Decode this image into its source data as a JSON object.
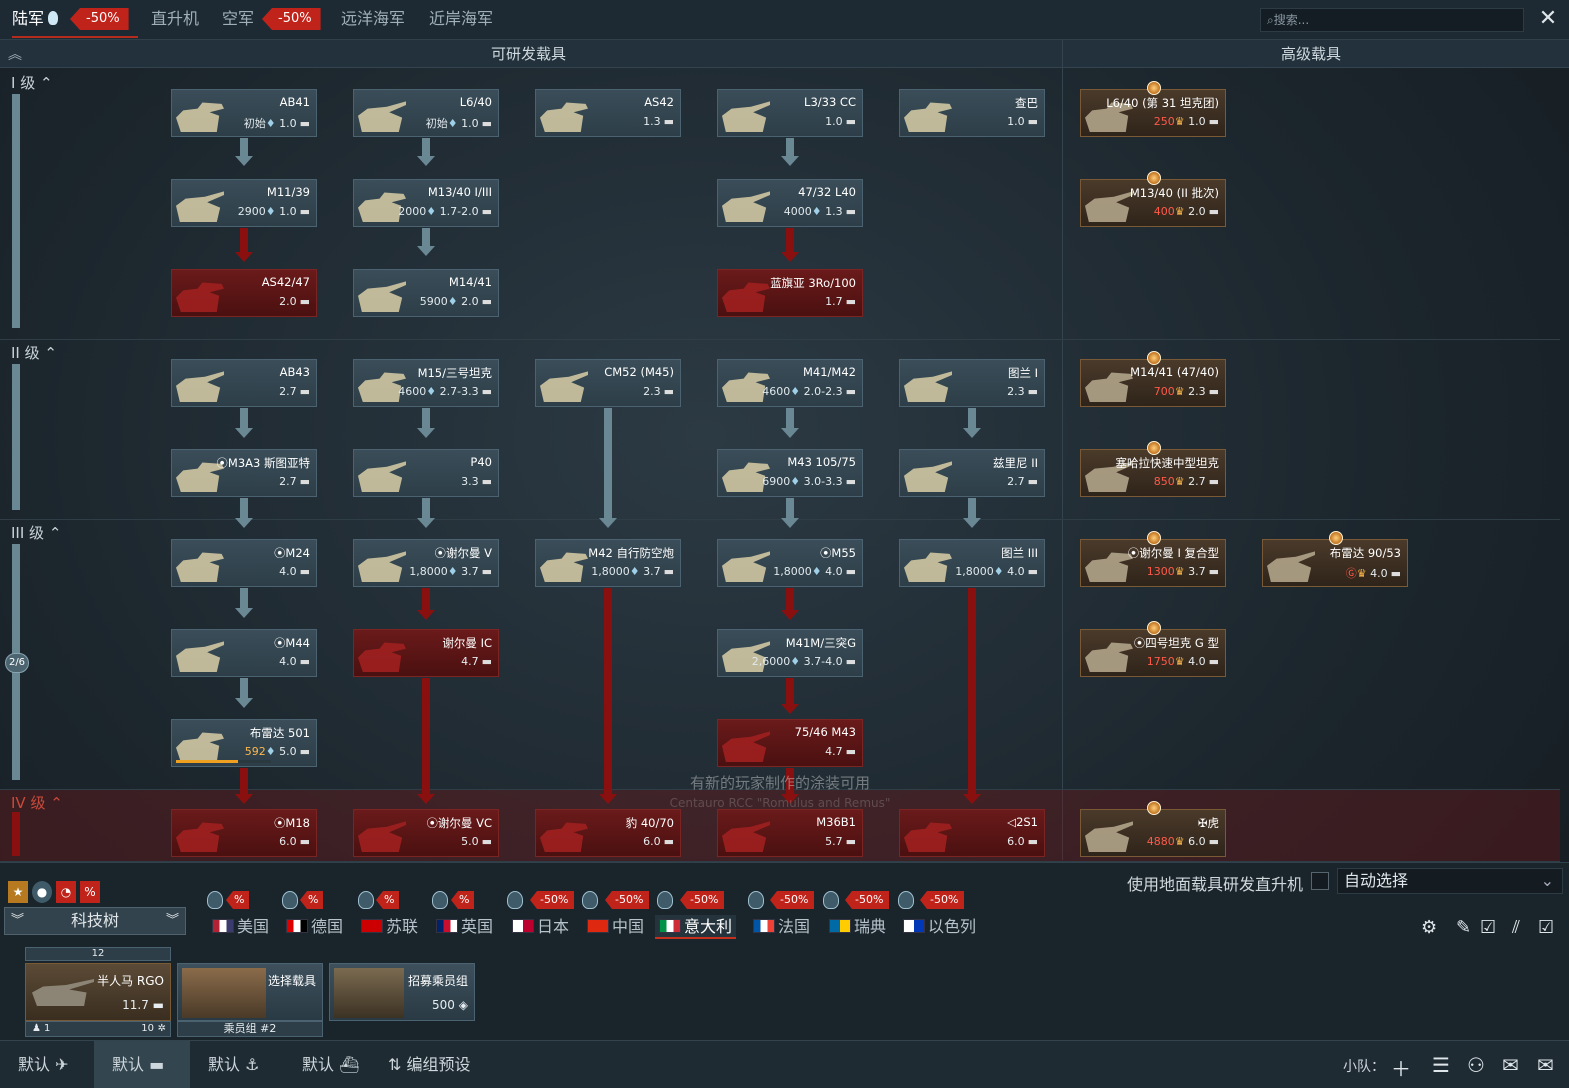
{
  "top_tabs": [
    {
      "label": "陆军",
      "discount": "-50%"
    },
    {
      "label": "直升机"
    },
    {
      "label": "空军",
      "discount": "-50%"
    },
    {
      "label": "远洋海军"
    },
    {
      "label": "近岸海军"
    }
  ],
  "search_placeholder": "搜索...",
  "headers": {
    "researchable": "可研发载具",
    "premium": "高级载具"
  },
  "ranks": [
    "I 级",
    "II 级",
    "III 级",
    "IV 级"
  ],
  "progress_badge": "2/6",
  "research_cards": [
    {
      "name": "AB41",
      "cost": "初始",
      "br": "1.0",
      "state": "normal"
    },
    {
      "name": "L6/40",
      "cost": "初始",
      "br": "1.0",
      "state": "normal"
    },
    {
      "name": "AS42",
      "cost": "",
      "br": "1.3",
      "state": "normal"
    },
    {
      "name": "L3/33 CC",
      "cost": "",
      "br": "1.0",
      "state": "normal"
    },
    {
      "name": "查巴",
      "cost": "",
      "br": "1.0",
      "state": "normal"
    },
    {
      "name": "M11/39",
      "cost": "2900",
      "br": "1.0",
      "state": "normal"
    },
    {
      "name": "M13/40 I/III",
      "cost": "2000",
      "br": "1.7-2.0",
      "state": "normal"
    },
    {
      "name": "47/32 L40",
      "cost": "4000",
      "br": "1.3",
      "state": "normal"
    },
    {
      "name": "AS42/47",
      "cost": "",
      "br": "2.0",
      "state": "locked"
    },
    {
      "name": "M14/41",
      "cost": "5900",
      "br": "2.0",
      "state": "normal"
    },
    {
      "name": "蓝旗亚 3Ro/100",
      "cost": "",
      "br": "1.7",
      "state": "locked"
    },
    {
      "name": "AB43",
      "cost": "",
      "br": "2.7",
      "state": "normal"
    },
    {
      "name": "M15/三号坦克",
      "cost": "4600",
      "br": "2.7-3.3",
      "state": "normal"
    },
    {
      "name": "CM52 (M45)",
      "cost": "",
      "br": "2.3",
      "state": "normal"
    },
    {
      "name": "M41/M42",
      "cost": "4600",
      "br": "2.0-2.3",
      "state": "normal"
    },
    {
      "name": "图兰 I",
      "cost": "",
      "br": "2.3",
      "state": "normal"
    },
    {
      "name": "⦿M3A3 斯图亚特",
      "cost": "",
      "br": "2.7",
      "state": "normal"
    },
    {
      "name": "P40",
      "cost": "",
      "br": "3.3",
      "state": "normal"
    },
    {
      "name": "M43 105/75",
      "cost": "6900",
      "br": "3.0-3.3",
      "state": "normal"
    },
    {
      "name": "兹里尼 II",
      "cost": "",
      "br": "2.7",
      "state": "normal"
    },
    {
      "name": "⦿M24",
      "cost": "",
      "br": "4.0",
      "state": "normal"
    },
    {
      "name": "⦿谢尔曼 V",
      "cost": "1,8000",
      "br": "3.7",
      "state": "normal"
    },
    {
      "name": "M42 自行防空炮",
      "cost": "1,8000",
      "br": "3.7",
      "state": "normal"
    },
    {
      "name": "⦿M55",
      "cost": "1,8000",
      "br": "4.0",
      "state": "normal"
    },
    {
      "name": "图兰 III",
      "cost": "1,8000",
      "br": "4.0",
      "state": "normal"
    },
    {
      "name": "⦿M44",
      "cost": "",
      "br": "4.0",
      "state": "normal"
    },
    {
      "name": "谢尔曼 IC",
      "cost": "",
      "br": "4.7",
      "state": "locked"
    },
    {
      "name": "M41M/三突G",
      "cost": "2,6000",
      "br": "3.7-4.0",
      "state": "normal"
    },
    {
      "name": "布雷达 501",
      "cost": "592",
      "br": "5.0",
      "state": "normal",
      "progress": 0.65
    },
    {
      "name": "75/46 M43",
      "cost": "",
      "br": "4.7",
      "state": "locked"
    },
    {
      "name": "⦿M18",
      "cost": "",
      "br": "6.0",
      "state": "locked"
    },
    {
      "name": "⦿谢尔曼 VC",
      "cost": "",
      "br": "5.0",
      "state": "locked"
    },
    {
      "name": "豹 40/70",
      "cost": "",
      "br": "6.0",
      "state": "locked"
    },
    {
      "name": "M36B1",
      "cost": "",
      "br": "5.7",
      "state": "locked"
    },
    {
      "name": "◁2S1",
      "cost": "",
      "br": "6.0",
      "state": "locked"
    }
  ],
  "premium_cards": [
    {
      "name": "L6/40 (第 31 坦克团)",
      "cost": "250",
      "br": "1.0"
    },
    {
      "name": "M13/40 (II 批次)",
      "cost": "400",
      "br": "2.0"
    },
    {
      "name": "M14/41 (47/40)",
      "cost": "700",
      "br": "2.3"
    },
    {
      "name": "塞哈拉快速中型坦克",
      "cost": "850",
      "br": "2.7"
    },
    {
      "name": "⦿谢尔曼 I 复合型",
      "cost": "1300",
      "br": "3.7"
    },
    {
      "name": "布雷达 90/53",
      "cost": "Ⓖ",
      "br": "4.0"
    },
    {
      "name": "⦿四号坦克 G 型",
      "cost": "1750",
      "br": "4.0"
    },
    {
      "name": "✠虎",
      "cost": "4880",
      "br": "6.0"
    }
  ],
  "ghost_text": {
    "line1": "有新的玩家制作的涂装可用",
    "line2": "Centauro RCC \"Romulus and Remus\""
  },
  "bottom_panel": {
    "heli_option": "使用地面载具研发直升机",
    "auto_select": "自动选择",
    "tech_tree": "科技树",
    "nations": [
      {
        "name": "美国",
        "colors": [
          "#b22234",
          "#ffffff",
          "#3c3b6e"
        ]
      },
      {
        "name": "德国",
        "colors": [
          "#d00",
          "#fff",
          "#000"
        ]
      },
      {
        "name": "苏联",
        "colors": [
          "#cc0000"
        ]
      },
      {
        "name": "英国",
        "colors": [
          "#012169",
          "#c8102e",
          "#fff"
        ]
      },
      {
        "name": "日本",
        "colors": [
          "#fff",
          "#bc002d"
        ]
      },
      {
        "name": "中国",
        "colors": [
          "#de2910"
        ]
      },
      {
        "name": "意大利",
        "colors": [
          "#009246",
          "#fff",
          "#ce2b37"
        ]
      },
      {
        "name": "法国",
        "colors": [
          "#0055a4",
          "#fff",
          "#ef4135"
        ]
      },
      {
        "name": "瑞典",
        "colors": [
          "#006aa7",
          "#fecc00"
        ]
      },
      {
        "name": "以色列",
        "colors": [
          "#fff",
          "#0038b8"
        ]
      }
    ],
    "nation_discounts": [
      "-50%",
      "-50%",
      "-50%",
      "-50%",
      "-50%",
      "-50%"
    ],
    "crew_slot": {
      "top": "12",
      "name": "半人马 RGO",
      "br": "11.7",
      "crew": "1",
      "level": "10"
    },
    "select_vehicle": "选择载具",
    "crew_group": "乘员组 #2",
    "recruit": "招募乘员组",
    "recruit_cost": "500"
  },
  "bottom_tabs": [
    "默认",
    "默认",
    "默认",
    "默认",
    "编组预设"
  ],
  "squad_label": "小队："
}
